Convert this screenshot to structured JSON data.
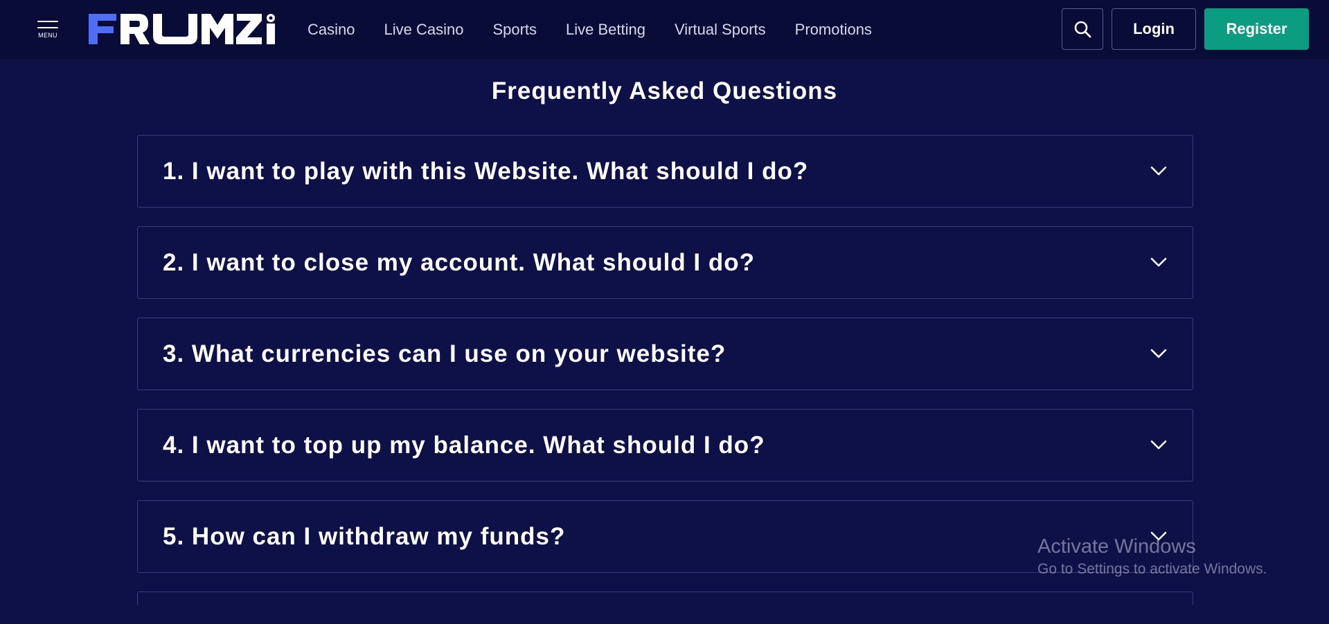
{
  "header": {
    "menu_label": "MENU",
    "logo_text": "FRUMZI",
    "nav": [
      "Casino",
      "Live Casino",
      "Sports",
      "Live Betting",
      "Virtual Sports",
      "Promotions"
    ],
    "login_label": "Login",
    "register_label": "Register",
    "search_icon": "search-icon"
  },
  "faq": {
    "title": "Frequently Asked Questions",
    "items": [
      "1. I want to play with this Website. What should I do?",
      "2. I want to close my account. What should I do?",
      "3. What currencies can I use on your website?",
      "4. I want to top up my balance. What should I do?",
      "5. How can I withdraw my funds?"
    ]
  },
  "watermark": {
    "title": "Activate Windows",
    "subtitle": "Go to Settings to activate Windows."
  },
  "colors": {
    "background": "#0e1148",
    "header": "#0a0c38",
    "register": "#0b9c82",
    "logo_blue": "#4f6df5",
    "border": "#3b3f78"
  }
}
